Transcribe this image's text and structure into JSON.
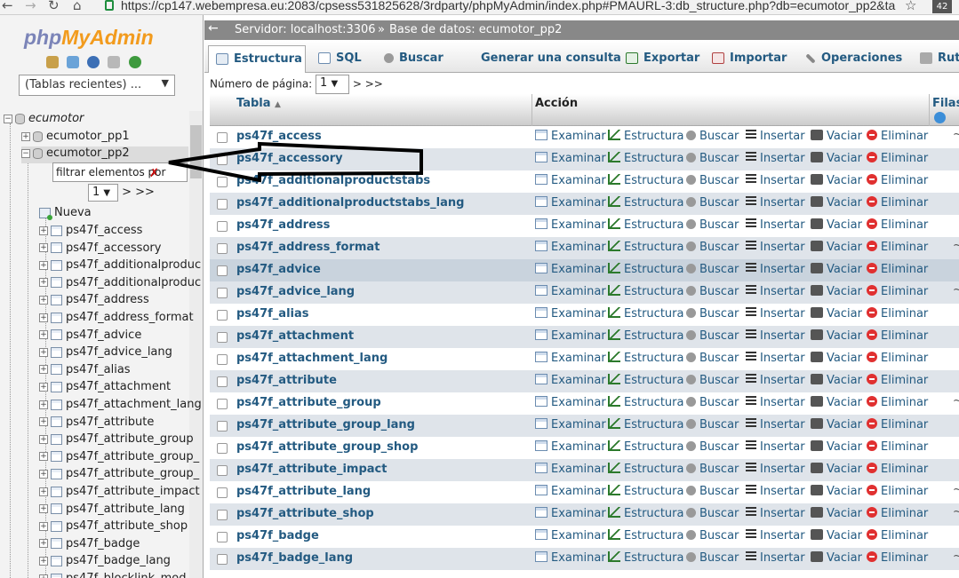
{
  "browser": {
    "url": "https://cp147.webempresa.eu:2083/cpsess531825628/3rdparty/phpMyAdmin/index.php#PMAURL-3:db_structure.php?db=ecumotor_pp2&ta",
    "extension_badge": "42"
  },
  "sidebar": {
    "logo_php": "php",
    "logo_myadmin": "MyAdmin",
    "recent_tables": "(Tablas recientes) ...",
    "tree": {
      "root": "ecumotor",
      "db1": "ecumotor_pp1",
      "db2": "ecumotor_pp2",
      "filter_value": "filtrar elementos por",
      "page": "1",
      "pager_next": "> >>",
      "new_label": "Nueva",
      "tables": [
        "ps47f_access",
        "ps47f_accessory",
        "ps47f_additionalproduc",
        "ps47f_additionalproduc",
        "ps47f_address",
        "ps47f_address_format",
        "ps47f_advice",
        "ps47f_advice_lang",
        "ps47f_alias",
        "ps47f_attachment",
        "ps47f_attachment_lang",
        "ps47f_attribute",
        "ps47f_attribute_group",
        "ps47f_attribute_group_",
        "ps47f_attribute_group_",
        "ps47f_attribute_impact",
        "ps47f_attribute_lang",
        "ps47f_attribute_shop",
        "ps47f_badge",
        "ps47f_badge_lang",
        "ps47f_blocklink_mod"
      ]
    }
  },
  "breadcrumb": {
    "server": "Servidor: localhost:3306",
    "sep": "»",
    "database": "Base de datos: ecumotor_pp2"
  },
  "tabs": [
    {
      "label": "Estructura"
    },
    {
      "label": "SQL"
    },
    {
      "label": "Buscar"
    },
    {
      "label": "Generar una consulta"
    },
    {
      "label": "Exportar"
    },
    {
      "label": "Importar"
    },
    {
      "label": "Operaciones"
    },
    {
      "label": "Rut"
    }
  ],
  "pagination": {
    "label": "Número de página:",
    "page": "1",
    "next": "> >>"
  },
  "table_header": {
    "tabla": "Tabla",
    "accion": "Acción",
    "filas": "Filas"
  },
  "actions": {
    "examinar": "Examinar",
    "estructura": "Estructura",
    "buscar": "Buscar",
    "insertar": "Insertar",
    "vaciar": "Vaciar",
    "eliminar": "Eliminar"
  },
  "rows": [
    {
      "name": "ps47f_access",
      "tail": "~"
    },
    {
      "name": "ps47f_accessory",
      "tail": ""
    },
    {
      "name": "ps47f_additionalproductstabs",
      "tail": ""
    },
    {
      "name": "ps47f_additionalproductstabs_lang",
      "tail": ""
    },
    {
      "name": "ps47f_address",
      "tail": ""
    },
    {
      "name": "ps47f_address_format",
      "tail": "~"
    },
    {
      "name": "ps47f_advice",
      "tail": ""
    },
    {
      "name": "ps47f_advice_lang",
      "tail": "~"
    },
    {
      "name": "ps47f_alias",
      "tail": ""
    },
    {
      "name": "ps47f_attachment",
      "tail": ""
    },
    {
      "name": "ps47f_attachment_lang",
      "tail": ""
    },
    {
      "name": "ps47f_attribute",
      "tail": ""
    },
    {
      "name": "ps47f_attribute_group",
      "tail": "~"
    },
    {
      "name": "ps47f_attribute_group_lang",
      "tail": ""
    },
    {
      "name": "ps47f_attribute_group_shop",
      "tail": ""
    },
    {
      "name": "ps47f_attribute_impact",
      "tail": ""
    },
    {
      "name": "ps47f_attribute_lang",
      "tail": "~"
    },
    {
      "name": "ps47f_attribute_shop",
      "tail": "~"
    },
    {
      "name": "ps47f_badge",
      "tail": ""
    },
    {
      "name": "ps47f_badge_lang",
      "tail": "~1,"
    }
  ],
  "colors": {
    "link": "#235a81",
    "server_bar": "#888888",
    "row_even": "#dfe4ea",
    "row_highlight": "#c9d3dd",
    "delete": "#e03030"
  }
}
